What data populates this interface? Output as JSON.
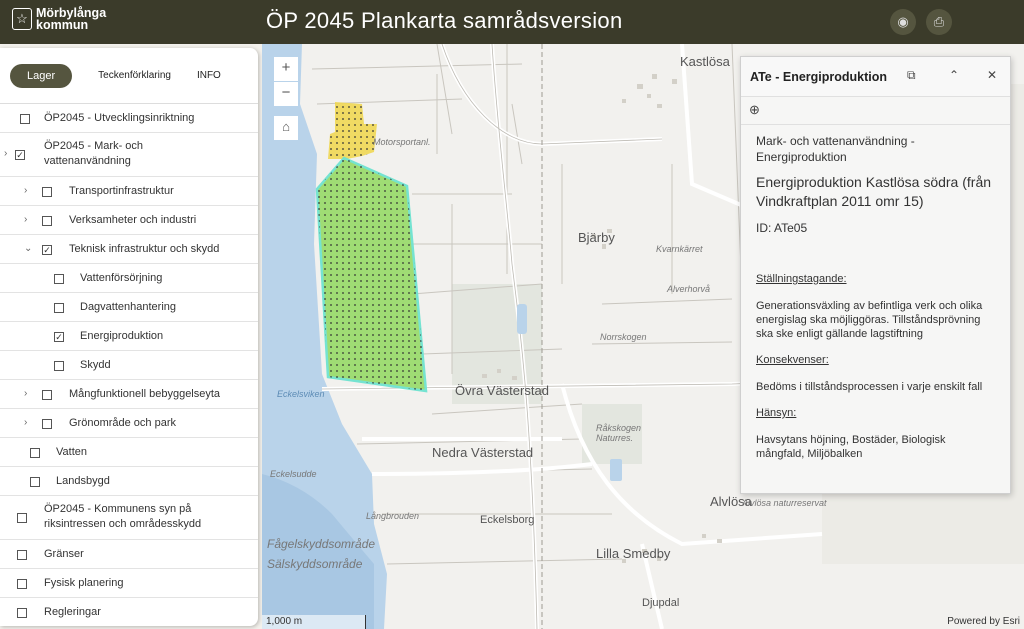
{
  "header": {
    "logo_line1": "Mörbylånga",
    "logo_line2": "kommun",
    "title": "ÖP 2045  Plankarta samrådsversion",
    "icons": [
      "visibility-icon",
      "print-icon"
    ]
  },
  "sidebar": {
    "tabs": [
      "Lager",
      "Teckenförklaring",
      "INFO"
    ],
    "layers": [
      {
        "label": "ÖP2045 - Utvecklingsinriktning",
        "checked": false,
        "expander": false
      },
      {
        "label": "ÖP2045 - Mark- och vattenanvändning",
        "checked": true,
        "expander": true
      },
      {
        "label": "Transportinfrastruktur",
        "checked": false,
        "expander": true
      },
      {
        "label": "Verksamheter och industri",
        "checked": false,
        "expander": true
      },
      {
        "label": "Teknisk infrastruktur och skydd",
        "checked": true,
        "expander": true
      },
      {
        "label": "Vattenförsörjning",
        "checked": false,
        "expander": false
      },
      {
        "label": "Dagvattenhantering",
        "checked": false,
        "expander": false
      },
      {
        "label": "Energiproduktion",
        "checked": true,
        "expander": false
      },
      {
        "label": "Skydd",
        "checked": false,
        "expander": false
      },
      {
        "label": "Mångfunktionell bebyggelseyta",
        "checked": false,
        "expander": true
      },
      {
        "label": "Grönområde och park",
        "checked": false,
        "expander": true
      },
      {
        "label": "Vatten",
        "checked": false,
        "expander": false
      },
      {
        "label": "Landsbygd",
        "checked": false,
        "expander": false
      },
      {
        "label": "ÖP2045 - Kommunens syn på riksintressen och områdesskydd",
        "checked": false,
        "expander": false
      },
      {
        "label": "Gränser",
        "checked": false,
        "expander": false
      },
      {
        "label": "Fysisk planering",
        "checked": false,
        "expander": false
      },
      {
        "label": "Regleringar",
        "checked": false,
        "expander": false
      }
    ]
  },
  "map": {
    "zoom_in": "+",
    "zoom_out": "−",
    "scale": "1,000 m",
    "powered_by": "Powered by Esri",
    "place_labels": [
      "Kastlösa",
      "Bjärby",
      "Kvarnkärret",
      "Alverhorvå",
      "Norrskogen",
      "Övra Västerstad",
      "Nedra Västerstad",
      "Råkskogen Naturres.",
      "Alvlösa",
      "Alvlösa naturreservat",
      "Eckelsborg",
      "Lilla Smedby",
      "Djupdal",
      "Långbrouden",
      "Eckelsudde",
      "Eckelsviken",
      "Motorsportanl.",
      "Fågelskyddsområde",
      "Sälskyddsområde"
    ],
    "colors": {
      "energy_zone": "#9bdb6e",
      "energy_outline": "#6fe3d0",
      "yellow_zone": "#f0d64a",
      "water": "#b9d3ea"
    }
  },
  "popup": {
    "title": "ATe - Energiproduktion",
    "category": "Mark- och vattenanvändning - Energiproduktion",
    "name": "Energiproduktion Kastlösa södra (från Vindkraftplan 2011 omr 15)",
    "id": "ID: ATe05",
    "sections": [
      {
        "heading": "Ställningstagande:",
        "text": "Generationsväxling av befintliga verk och olika energislag ska möjliggöras. Tillståndsprövning ska ske enligt gällande lagstiftning"
      },
      {
        "heading": "Konsekvenser:",
        "text": "Bedöms i tillståndsprocessen i varje enskilt fall"
      },
      {
        "heading": "Hänsyn:",
        "text": "Havsytans höjning, Bostäder, Biologisk mångfald, Miljöbalken"
      }
    ]
  }
}
